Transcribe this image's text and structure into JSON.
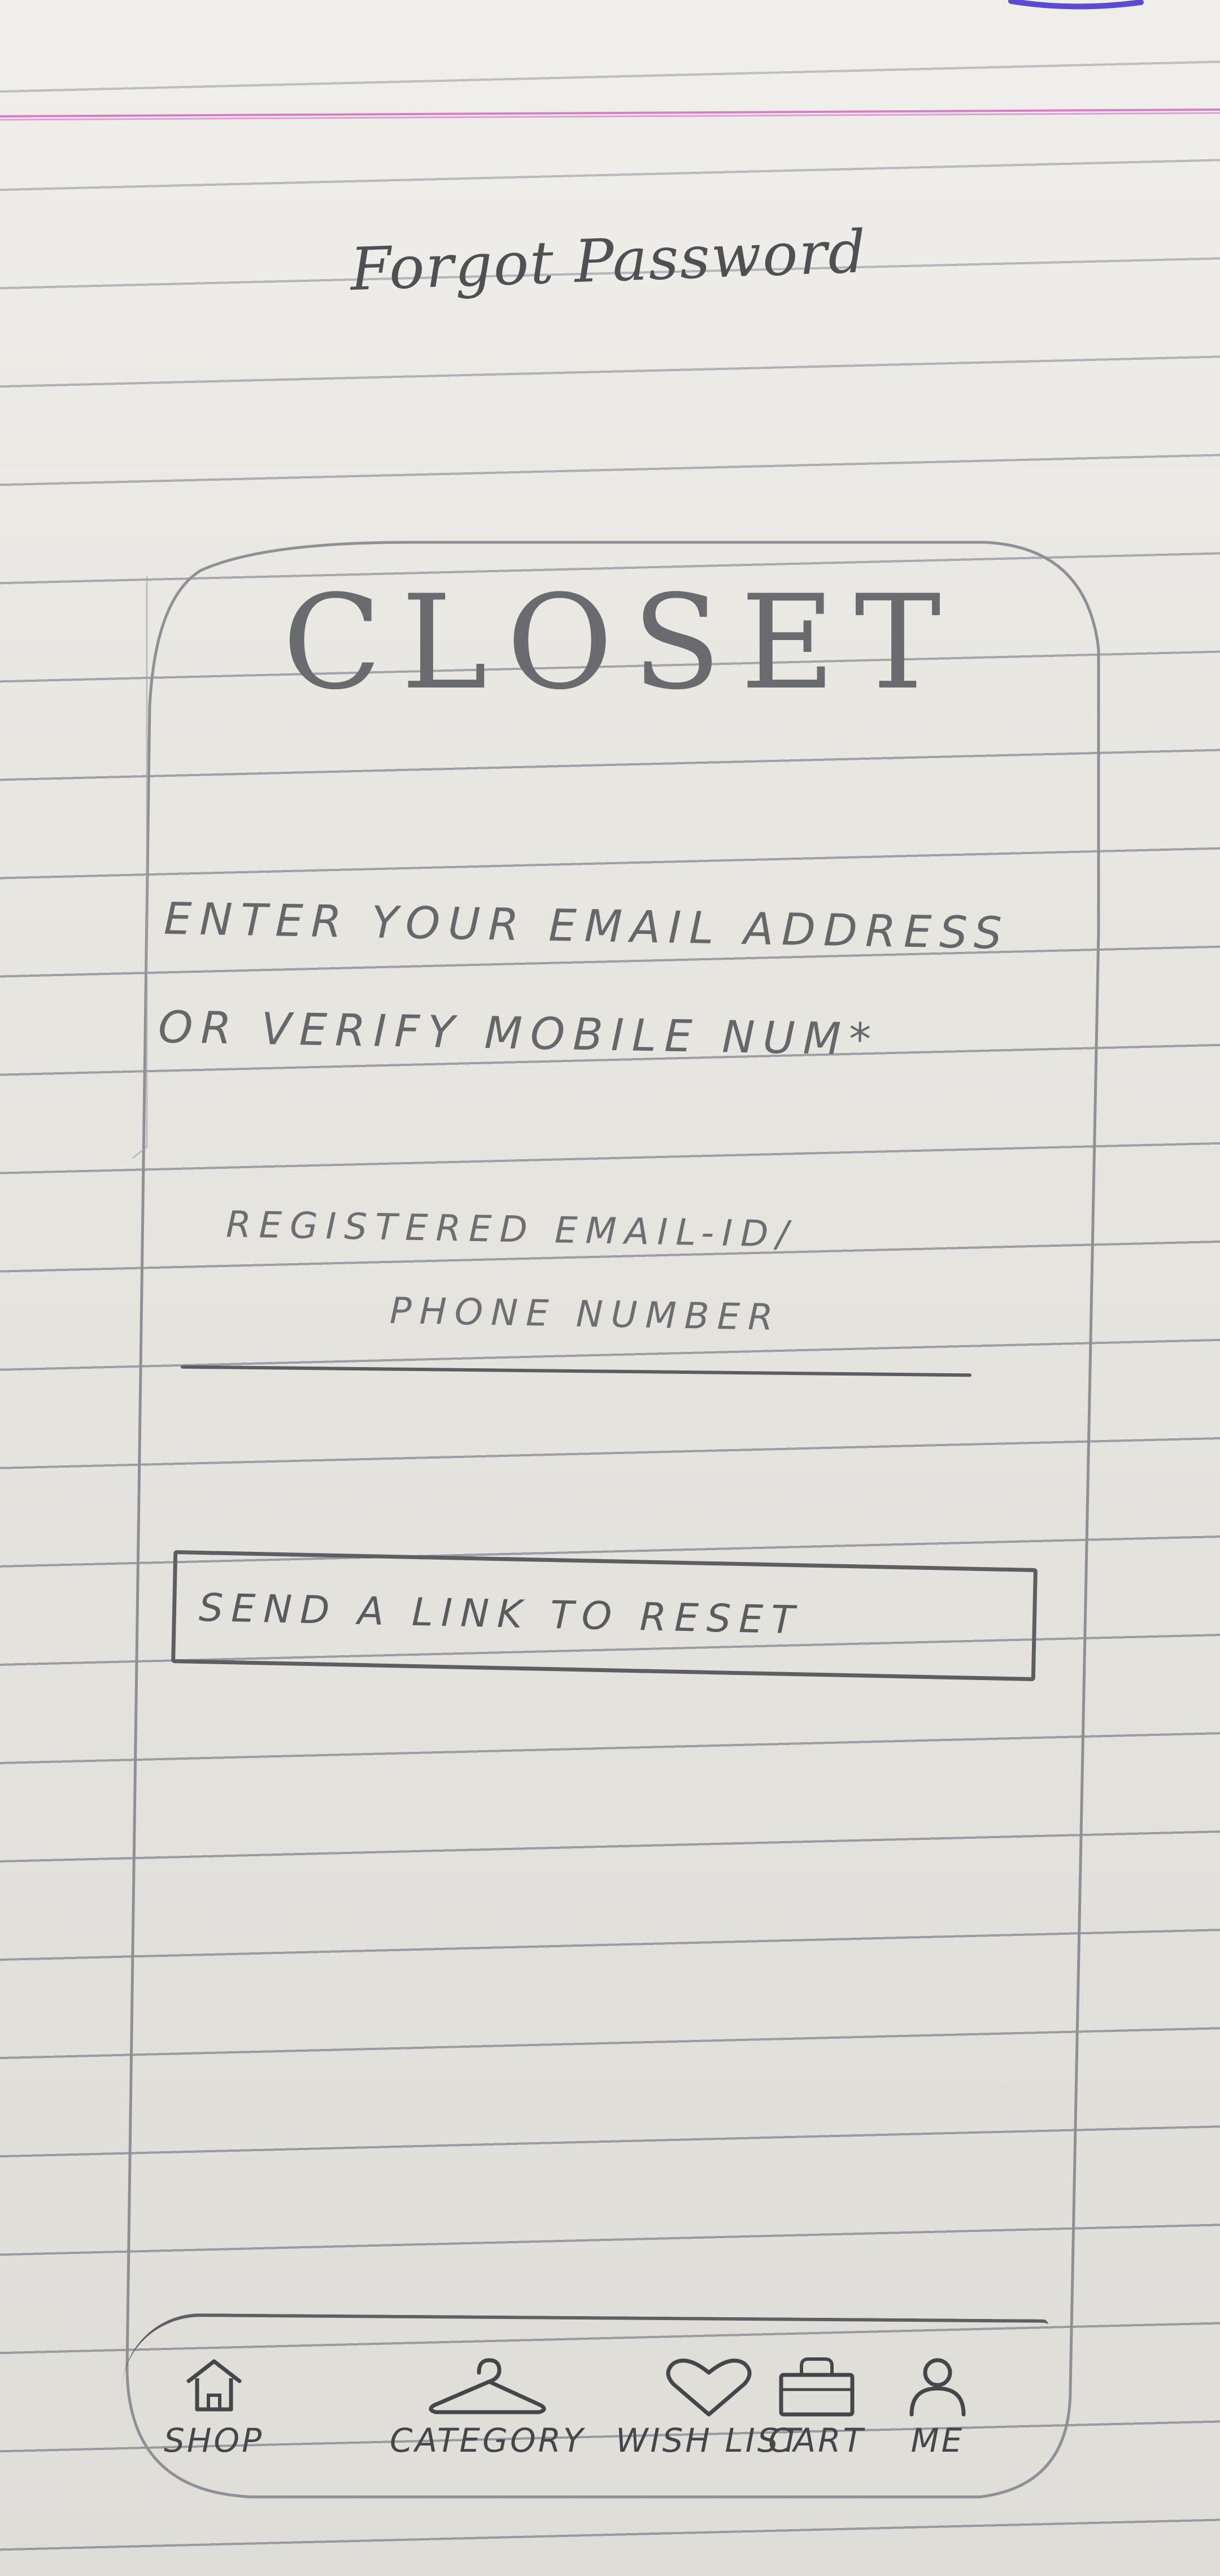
{
  "sheet": {
    "title": "Forgot Password"
  },
  "app": {
    "brand": "CLOSET"
  },
  "form": {
    "prompt_line_1": "ENTER YOUR EMAIL ADDRESS",
    "prompt_line_2": "OR VERIFY MOBILE NUM*",
    "input_hint_line_1": "REGISTERED EMAIL-ID/",
    "input_hint_line_2": "PHONE NUMBER",
    "submit_label": "SEND A LINK TO RESET"
  },
  "bottom_nav": {
    "items": [
      {
        "label": "SHOP",
        "icon": "home-icon"
      },
      {
        "label": "CATEGORY",
        "icon": "hanger-icon"
      },
      {
        "label": "WISH LIST",
        "icon": "heart-icon"
      },
      {
        "label": "CART",
        "icon": "bag-icon"
      },
      {
        "label": "ME",
        "icon": "person-icon"
      }
    ]
  },
  "colors": {
    "paper": "#e8e6e1",
    "rule_line": "#9da0a6",
    "margin_line": "#d67fc7",
    "pencil": "#5a5b5f"
  }
}
